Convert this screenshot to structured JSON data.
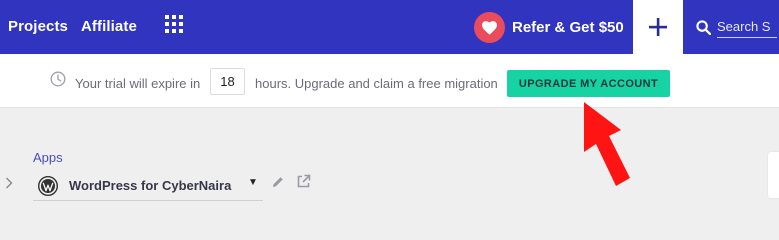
{
  "nav": {
    "projects": "Projects",
    "affiliate": "Affiliate",
    "apps_grid_icon": "grid-icon",
    "refer_label": "Refer & Get $50",
    "refer_icon": "heart-icon",
    "add_icon": "plus-icon",
    "search_icon": "search-icon",
    "search_placeholder": "Search S",
    "bg_color": "#3034bf"
  },
  "banner": {
    "clock_icon": "clock-icon",
    "text_before": "Your trial will expire in",
    "hours": "18",
    "text_after": "hours. Upgrade and claim a free migration",
    "button_label": "UPGRADE MY ACCOUNT",
    "button_color": "#17d3a3"
  },
  "annotation": {
    "arrow_color": "#ff1a1a",
    "arrow_icon": "red-arrow"
  },
  "apps": {
    "heading": "Apps",
    "items": [
      {
        "name": "WordPress for CyberNaira",
        "icon": "wordpress-icon"
      }
    ]
  }
}
